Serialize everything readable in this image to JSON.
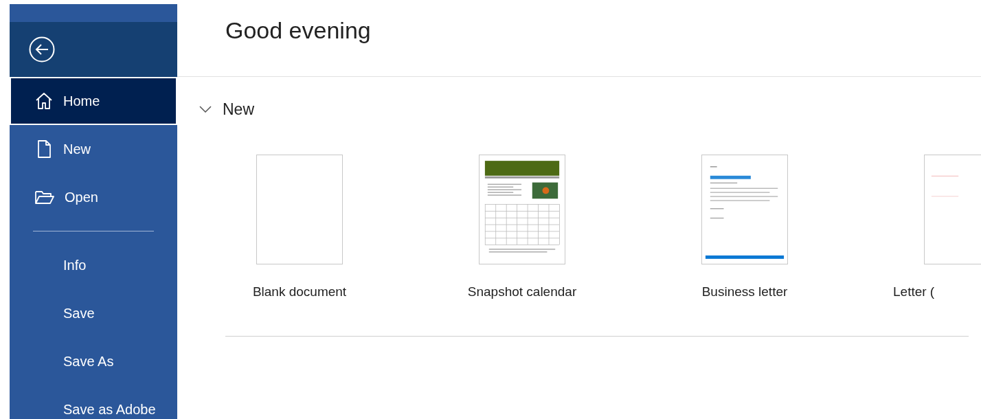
{
  "sidebar": {
    "items": [
      {
        "label": "Home",
        "kind": "home",
        "selected": true
      },
      {
        "label": "New",
        "kind": "page",
        "selected": false
      },
      {
        "label": "Open",
        "kind": "folder",
        "selected": false
      },
      {
        "kind": "divider"
      },
      {
        "label": "Info",
        "kind": "plain",
        "selected": false
      },
      {
        "label": "Save",
        "kind": "plain",
        "selected": false
      },
      {
        "label": "Save As",
        "kind": "plain",
        "selected": false
      },
      {
        "label": "Save as Adobe",
        "kind": "plain",
        "selected": false
      }
    ]
  },
  "greeting": "Good evening",
  "new_section": {
    "title": "New",
    "expanded": true,
    "templates": [
      {
        "label": "Blank document",
        "kind": "blank"
      },
      {
        "label": "Snapshot calendar",
        "kind": "calendar"
      },
      {
        "label": "Business letter",
        "kind": "letter"
      },
      {
        "label": "Letter (",
        "kind": "partial"
      }
    ]
  }
}
